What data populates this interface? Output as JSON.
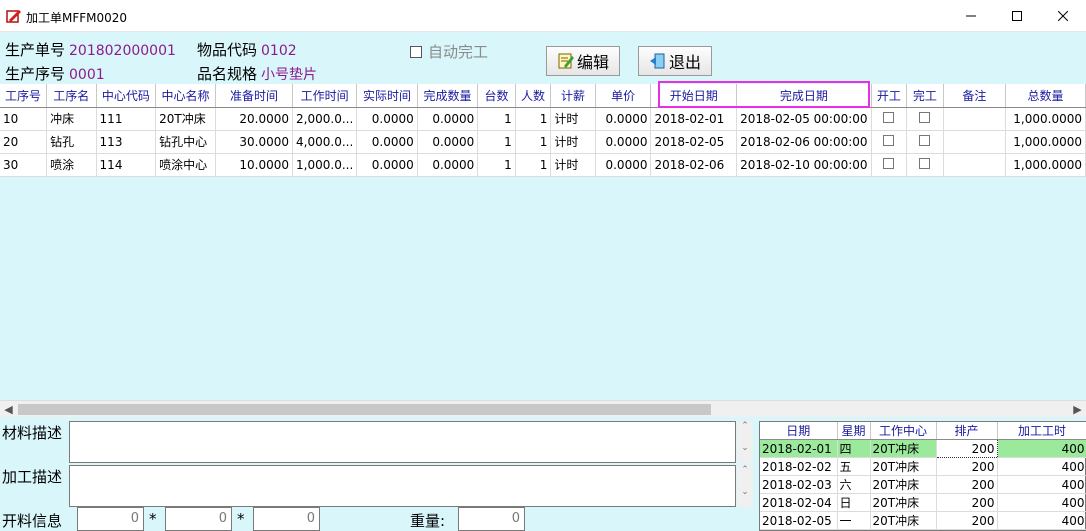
{
  "window": {
    "title": "加工单MFFM0020"
  },
  "header": {
    "order_no_label": "生产单号",
    "order_no": "201802000001",
    "seq_label": "生产序号",
    "seq": "0001",
    "item_code_label": "物品代码",
    "item_code": "0102",
    "spec_label": "品名规格",
    "spec": "小号垫片",
    "auto_done_label": "自动完工"
  },
  "toolbar": {
    "edit_label": "编辑",
    "exit_label": "退出"
  },
  "grid": {
    "columns": [
      "工序号",
      "工序名",
      "中心代码",
      "中心名称",
      "准备时间",
      "工作时间",
      "实际时间",
      "完成数量",
      "台数",
      "人数",
      "计薪",
      "单价",
      "开始日期",
      "完成日期",
      "开工",
      "完工",
      "备注",
      "总数量"
    ],
    "rows": [
      [
        "10",
        "冲床",
        "111",
        "20T冲床",
        "20.0000",
        "2,000.0...",
        "0.0000",
        "0.0000",
        "1",
        "1",
        "计时",
        "0.0000",
        "2018-02-01",
        "2018-02-05 00:00:00",
        "",
        "",
        "",
        "1,000.0000"
      ],
      [
        "20",
        "钻孔",
        "113",
        "钻孔中心",
        "30.0000",
        "4,000.0...",
        "0.0000",
        "0.0000",
        "1",
        "1",
        "计时",
        "0.0000",
        "2018-02-05",
        "2018-02-06 00:00:00",
        "",
        "",
        "",
        "1,000.0000"
      ],
      [
        "30",
        "喷涂",
        "114",
        "喷涂中心",
        "10.0000",
        "1,000.0...",
        "0.0000",
        "0.0000",
        "1",
        "1",
        "计时",
        "0.0000",
        "2018-02-06",
        "2018-02-10 00:00:00",
        "",
        "",
        "",
        "1,000.0000"
      ]
    ]
  },
  "bottom": {
    "material_label": "材料描述",
    "process_label": "加工描述",
    "cut_label": "开料信息",
    "cut_values": [
      "0",
      "0",
      "0"
    ],
    "star": "*",
    "weight_label": "重量:",
    "weight_value": "0"
  },
  "schedule": {
    "columns": [
      "日期",
      "星期",
      "工作中心",
      "排产",
      "加工工时"
    ],
    "rows": [
      [
        "2018-02-01",
        "四",
        "20T冲床",
        "200",
        "400"
      ],
      [
        "2018-02-02",
        "五",
        "20T冲床",
        "200",
        "400"
      ],
      [
        "2018-02-03",
        "六",
        "20T冲床",
        "200",
        "400"
      ],
      [
        "2018-02-04",
        "日",
        "20T冲床",
        "200",
        "400"
      ],
      [
        "2018-02-05",
        "一",
        "20T冲床",
        "200",
        "400"
      ]
    ]
  }
}
